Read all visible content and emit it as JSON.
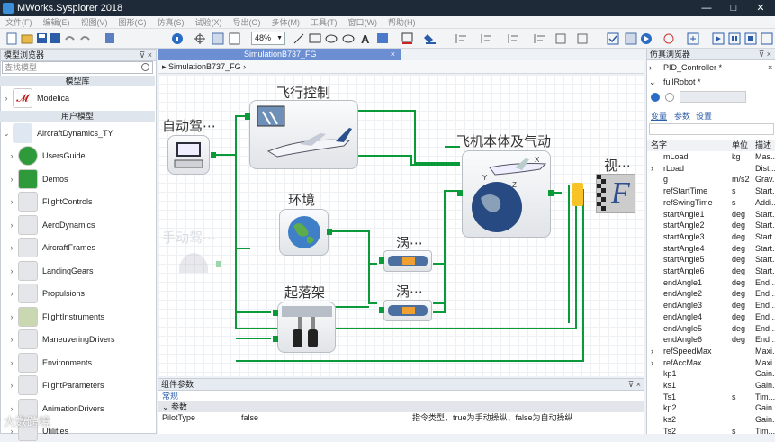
{
  "window": {
    "title": "MWorks.Sysplorer 2018",
    "min": "—",
    "max": "□",
    "close": "✕"
  },
  "menu": [
    "文件(F)",
    "编辑(E)",
    "视图(V)",
    "图形(G)",
    "仿真(S)",
    "试验(X)",
    "导出(O)",
    "多体(M)",
    "工具(T)",
    "窗口(W)",
    "帮助(H)"
  ],
  "toolbar": {
    "zoom": "48%"
  },
  "left_panel": {
    "title": "模型浏览器",
    "search_placeholder": "查找模型",
    "section_lib": "模型库",
    "lib_item": "Modelica",
    "section_user": "用户模型",
    "root": "AircraftDynamics_TY",
    "items": [
      "UsersGuide",
      "Demos",
      "FlightControls",
      "AeroDynamics",
      "AircraftFrames",
      "LandingGears",
      "Propulsions",
      "FlightInstruments",
      "ManeuveringDrivers",
      "Environments",
      "FlightParameters",
      "AnimationDrivers",
      "Utilities"
    ]
  },
  "doc_tab": {
    "label": "SimulationB737_FG",
    "close": "×",
    "path": "SimulationB737_FG"
  },
  "diagram": {
    "autopilot": "自动驾⋯",
    "flight_control": "飞行控制",
    "environment": "环境",
    "manual": "手动驾⋯",
    "landing_gear": "起落架",
    "engine1": "涡⋯",
    "engine2": "涡⋯",
    "aircraft": "飞机本体及气动",
    "visual": "视⋯",
    "visual_letter": "F"
  },
  "bottom_panel": {
    "title": "组件参数",
    "tab": "常规",
    "section": "参数",
    "param_name": "PilotType",
    "param_value": "false",
    "param_desc": "指令类型，true为手动操纵、false为自动操纵"
  },
  "right_panel": {
    "title": "仿真浏览器",
    "models": [
      "PID_Controller *",
      "fullRobot *"
    ],
    "tabs": [
      "变量",
      "参数",
      "设置"
    ],
    "cols": [
      "名字",
      "单位",
      "描述"
    ],
    "rows": [
      {
        "name": "mLoad",
        "unit": "kg",
        "desc": "Mas..."
      },
      {
        "name": "rLoad",
        "unit": "",
        "desc": "Dist..."
      },
      {
        "name": "g",
        "unit": "m/s2",
        "desc": "Grav..."
      },
      {
        "name": "refStartTime",
        "unit": "s",
        "desc": "Start..."
      },
      {
        "name": "refSwingTime",
        "unit": "s",
        "desc": "Addi..."
      },
      {
        "name": "startAngle1",
        "unit": "deg",
        "desc": "Start..."
      },
      {
        "name": "startAngle2",
        "unit": "deg",
        "desc": "Start..."
      },
      {
        "name": "startAngle3",
        "unit": "deg",
        "desc": "Start..."
      },
      {
        "name": "startAngle4",
        "unit": "deg",
        "desc": "Start..."
      },
      {
        "name": "startAngle5",
        "unit": "deg",
        "desc": "Start..."
      },
      {
        "name": "startAngle6",
        "unit": "deg",
        "desc": "Start..."
      },
      {
        "name": "endAngle1",
        "unit": "deg",
        "desc": "End ..."
      },
      {
        "name": "endAngle2",
        "unit": "deg",
        "desc": "End ..."
      },
      {
        "name": "endAngle3",
        "unit": "deg",
        "desc": "End ..."
      },
      {
        "name": "endAngle4",
        "unit": "deg",
        "desc": "End ..."
      },
      {
        "name": "endAngle5",
        "unit": "deg",
        "desc": "End ..."
      },
      {
        "name": "endAngle6",
        "unit": "deg",
        "desc": "End ..."
      },
      {
        "name": "refSpeedMax",
        "unit": "",
        "desc": "Maxi..."
      },
      {
        "name": "refAccMax",
        "unit": "",
        "desc": "Maxi..."
      },
      {
        "name": "kp1",
        "unit": "",
        "desc": "Gain..."
      },
      {
        "name": "ks1",
        "unit": "",
        "desc": "Gain..."
      },
      {
        "name": "Ts1",
        "unit": "s",
        "desc": "Tim..."
      },
      {
        "name": "kp2",
        "unit": "",
        "desc": "Gain..."
      },
      {
        "name": "ks2",
        "unit": "",
        "desc": "Gain..."
      },
      {
        "name": "Ts2",
        "unit": "s",
        "desc": "Tim..."
      }
    ]
  },
  "watermark": "大数跨境"
}
